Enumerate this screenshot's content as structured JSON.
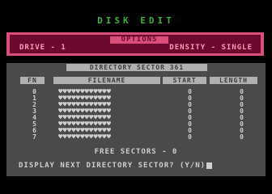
{
  "app": {
    "title": "DISK EDIT"
  },
  "options": {
    "label": "OPTIONS",
    "drive": "DRIVE - 1",
    "density": "DENSITY - SINGLE"
  },
  "directory": {
    "title": "DIRECTORY SECTOR 361",
    "columns": {
      "fn": "FN",
      "filename": "FILENAME",
      "start": "START",
      "length": "LENGTH"
    },
    "rows": [
      {
        "fn": "0",
        "filename": "♥♥♥♥♥♥♥♥♥♥♥♥",
        "start": "0",
        "length": "0"
      },
      {
        "fn": "1",
        "filename": "♥♥♥♥♥♥♥♥♥♥♥♥",
        "start": "0",
        "length": "0"
      },
      {
        "fn": "2",
        "filename": "♥♥♥♥♥♥♥♥♥♥♥♥",
        "start": "0",
        "length": "0"
      },
      {
        "fn": "3",
        "filename": "♥♥♥♥♥♥♥♥♥♥♥♥",
        "start": "0",
        "length": "0"
      },
      {
        "fn": "4",
        "filename": "♥♥♥♥♥♥♥♥♥♥♥♥",
        "start": "0",
        "length": "0"
      },
      {
        "fn": "5",
        "filename": "♥♥♥♥♥♥♥♥♥♥♥♥",
        "start": "0",
        "length": "0"
      },
      {
        "fn": "6",
        "filename": "♥♥♥♥♥♥♥♥♥♥♥♥",
        "start": "0",
        "length": "0"
      },
      {
        "fn": "7",
        "filename": "♥♥♥♥♥♥♥♥♥♥♥♥",
        "start": "0",
        "length": "0"
      }
    ],
    "free_sectors": "FREE SECTORS - 0",
    "prompt": "DISPLAY NEXT DIRECTORY SECTOR? (Y/N)"
  },
  "colors": {
    "background": "#000000",
    "title_green": "#3fae3f",
    "options_border": "#d94f7a",
    "options_fill": "#6b0a2e",
    "options_text": "#ff9ab8",
    "panel_gray": "#4a4a4a",
    "header_gray": "#b0b0b0",
    "text_light": "#cfcfcf"
  }
}
